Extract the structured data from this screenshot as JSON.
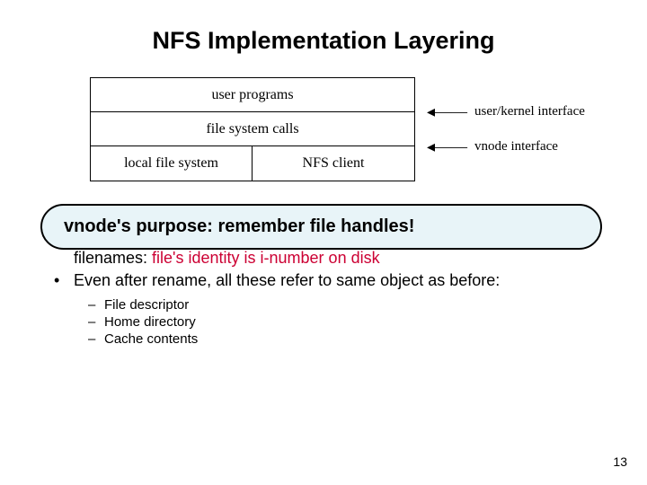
{
  "title": "NFS Implementation Layering",
  "diagram": {
    "rows": [
      {
        "type": "full",
        "text": "user programs"
      },
      {
        "type": "full",
        "text": "file system calls"
      },
      {
        "type": "split",
        "left": "local file system",
        "right": "NFS client"
      }
    ],
    "labels": {
      "user_kernel": "user/kernel interface",
      "vnode": "vnode interface"
    }
  },
  "callout": {
    "prefix": "vnode's purpose: ",
    "emphasis": "remember file handles!"
  },
  "overlapped": {
    "line1_plain": "filenames: ",
    "line1_red": "file's identity is i-number on disk"
  },
  "bullet": "Even after rename, all these refer to same object as before:",
  "sub_items": [
    "File descriptor",
    "Home directory",
    "Cache contents"
  ],
  "page_number": "13"
}
